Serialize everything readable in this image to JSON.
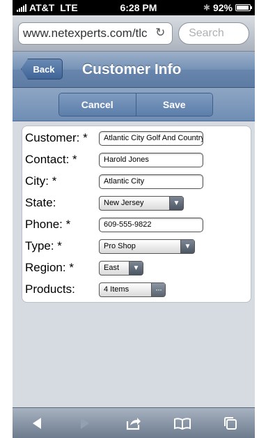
{
  "status_bar": {
    "carrier": "AT&T",
    "network": "LTE",
    "time": "6:28 PM",
    "battery": "92%",
    "battery_level": 0.92
  },
  "browser": {
    "url": "www.netexperts.com/tlc",
    "search_placeholder": "Search"
  },
  "nav": {
    "back_label": "Back",
    "title": "Customer Info"
  },
  "toolbar": {
    "cancel_label": "Cancel",
    "save_label": "Save"
  },
  "form": {
    "customer": {
      "label": "Customer: *",
      "value": "Atlantic City Golf And Country Club"
    },
    "contact": {
      "label": "Contact: *",
      "value": "Harold Jones"
    },
    "city": {
      "label": "City: *",
      "value": "Atlantic City"
    },
    "state": {
      "label": "State:",
      "value": "New Jersey"
    },
    "phone": {
      "label": "Phone: *",
      "value": "609-555-9822"
    },
    "type": {
      "label": "Type: *",
      "value": "Pro Shop"
    },
    "region": {
      "label": "Region: *",
      "value": "East"
    },
    "products": {
      "label": "Products:",
      "value": "4 Items"
    }
  },
  "bottom_toolbar": {
    "icons": [
      "back-arrow-icon",
      "forward-arrow-icon",
      "share-icon",
      "bookmarks-icon",
      "tabs-icon"
    ]
  }
}
